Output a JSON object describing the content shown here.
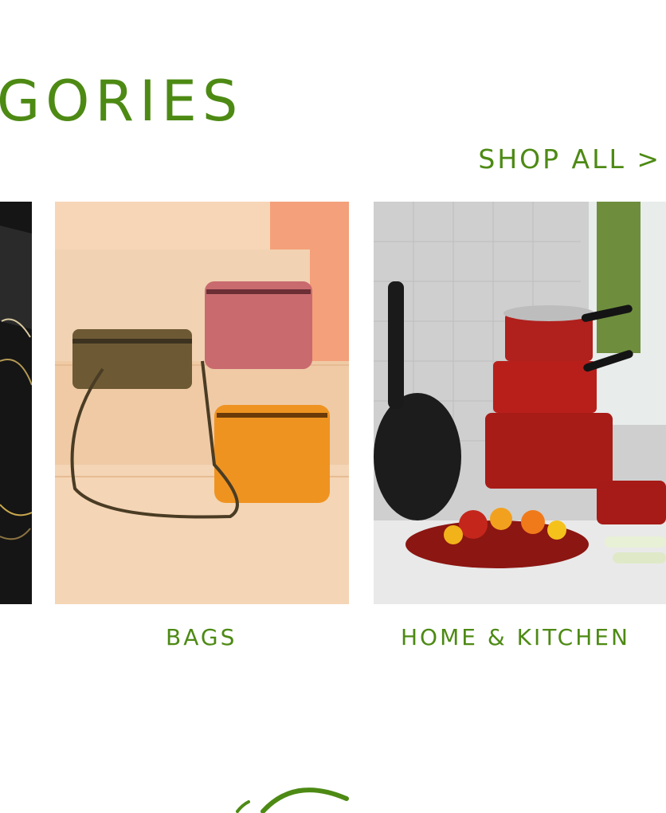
{
  "section": {
    "title": "GORIES",
    "shop_all_label": "SHOP ALL >"
  },
  "categories": [
    {
      "label": "BAGS",
      "image": "handbags-on-steps"
    },
    {
      "label": "HOME & KITCHEN",
      "image": "red-cookware-set"
    }
  ],
  "colors": {
    "accent": "#4d8a14",
    "background": "#ffffff"
  }
}
